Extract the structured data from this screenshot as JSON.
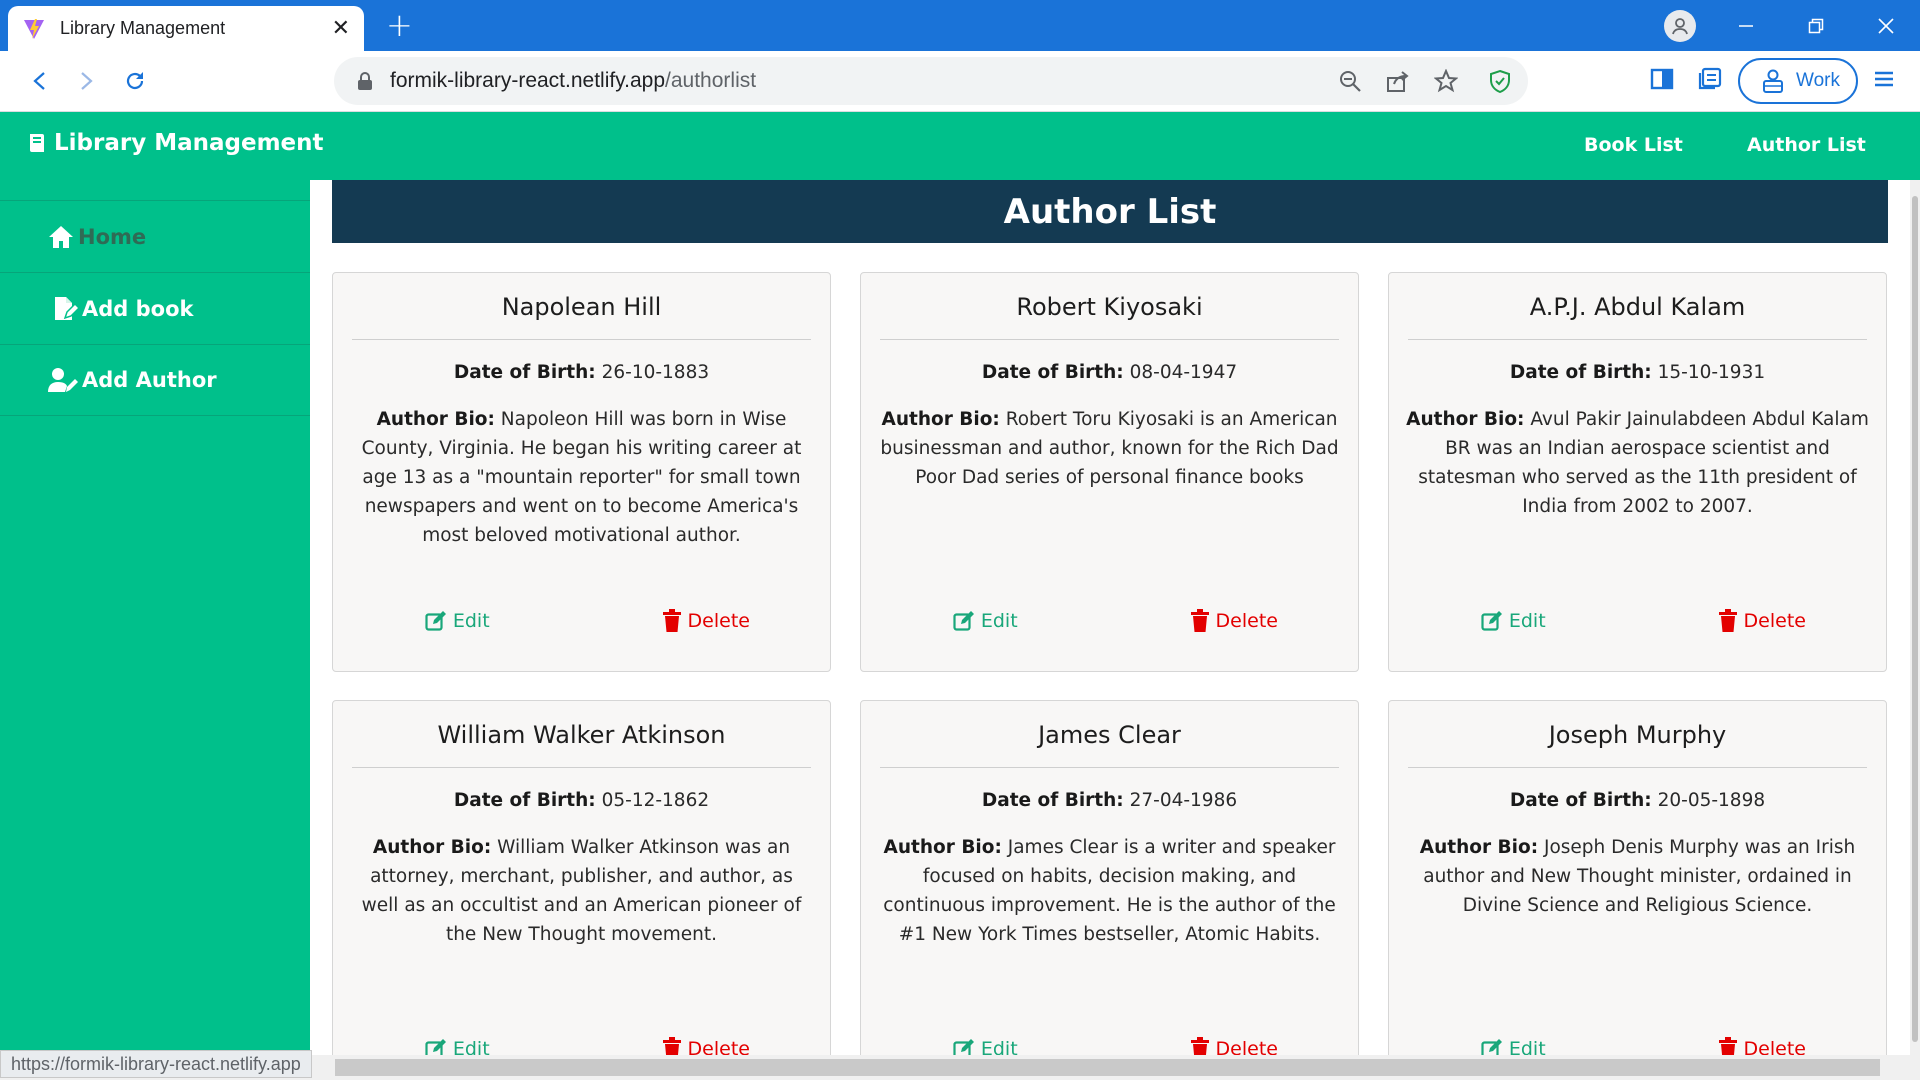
{
  "browser": {
    "tab_title": "Library Management",
    "url_domain": "formik-library-react.netlify.app",
    "url_path": "/authorlist",
    "profile_label": "Work",
    "status_url": "https://formik-library-react.netlify.app",
    "accent_color": "#1a73d8"
  },
  "app": {
    "brand": "Library Management",
    "nav_links": [
      "Book List",
      "Author List"
    ],
    "sidebar": [
      {
        "label": "Home",
        "icon": "home-icon"
      },
      {
        "label": "Add book",
        "icon": "file-edit-icon"
      },
      {
        "label": "Add Author",
        "icon": "user-edit-icon"
      }
    ],
    "page_title": "Author List",
    "theme_color": "#00c08b",
    "banner_color": "#143a52",
    "dob_label": "Date of Birth:",
    "bio_label": "Author Bio:",
    "edit_label": "Edit",
    "delete_label": "Delete",
    "authors": [
      {
        "name": "Napolean Hill",
        "dob": "26-10-1883",
        "bio": "Napoleon Hill was born in Wise County, Virginia. He began his writing career at age 13 as a \"mountain reporter\" for small town newspapers and went on to become America's most beloved motivational author."
      },
      {
        "name": "Robert Kiyosaki",
        "dob": "08-04-1947",
        "bio": "Robert Toru Kiyosaki is an American businessman and author, known for the Rich Dad Poor Dad series of personal finance books"
      },
      {
        "name": "A.P.J. Abdul Kalam",
        "dob": "15-10-1931",
        "bio": "Avul Pakir Jainulabdeen Abdul Kalam BR was an Indian aerospace scientist and statesman who served as the 11th president of India from 2002 to 2007."
      },
      {
        "name": "William Walker Atkinson",
        "dob": "05-12-1862",
        "bio": "William Walker Atkinson was an attorney, merchant, publisher, and author, as well as an occultist and an American pioneer of the New Thought movement."
      },
      {
        "name": "James Clear",
        "dob": "27-04-1986",
        "bio": "James Clear is a writer and speaker focused on habits, decision making, and continuous improvement. He is the author of the #1 New York Times bestseller, Atomic Habits."
      },
      {
        "name": "Joseph Murphy",
        "dob": "20-05-1898",
        "bio": "Joseph Denis Murphy was an Irish author and New Thought minister, ordained in Divine Science and Religious Science."
      }
    ]
  }
}
